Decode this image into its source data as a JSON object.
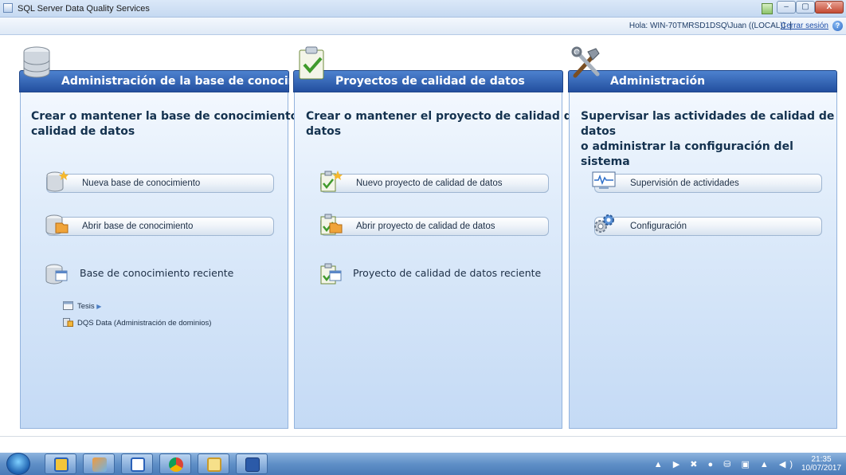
{
  "window": {
    "title": "SQL Server Data Quality Services",
    "controls": {
      "minimize": "–",
      "maximize": "▢",
      "close": "X"
    }
  },
  "session": {
    "greeting": "Hola: WIN-70TMRSD1DSQ\\Juan ((LOCAL))",
    "separator": "|",
    "logout": "Cerrar sesión",
    "help": "?"
  },
  "panels": {
    "kb": {
      "header": "Administración de la base de conocimiento",
      "subtitle_line1": "Crear o mantener la base de conocimiento de",
      "subtitle_line2": "calidad de datos",
      "new_label": "Nueva base de conocimiento",
      "open_label": "Abrir base de conocimiento",
      "recent_label": "Base de conocimiento reciente",
      "recent_items": [
        {
          "label": "Tesis",
          "arrow": "▶"
        },
        {
          "label": "DQS Data (Administración de dominios)"
        }
      ]
    },
    "project": {
      "header": "Proyectos de calidad de datos",
      "subtitle_line1": "Crear o mantener el proyecto de calidad de",
      "subtitle_line2": "datos",
      "new_label": "Nuevo proyecto de calidad de datos",
      "open_label": "Abrir proyecto de calidad de datos",
      "recent_label": "Proyecto de calidad de datos reciente"
    },
    "admin": {
      "header": "Administración",
      "subtitle_line1": "Supervisar las actividades de calidad de datos",
      "subtitle_line2": "o administrar la configuración del sistema",
      "monitor_label": "Supervisión de actividades",
      "config_label": "Configuración"
    }
  },
  "taskbar": {
    "tray_icons": "▲ ▶ ✖ ● ⛁ ▣ ▲ ◀)",
    "time": "21:35",
    "date": "10/07/2017"
  },
  "colors": {
    "header_blue": "#234f9f",
    "panel_light": "#deebfa",
    "title_text": "#14324f"
  }
}
